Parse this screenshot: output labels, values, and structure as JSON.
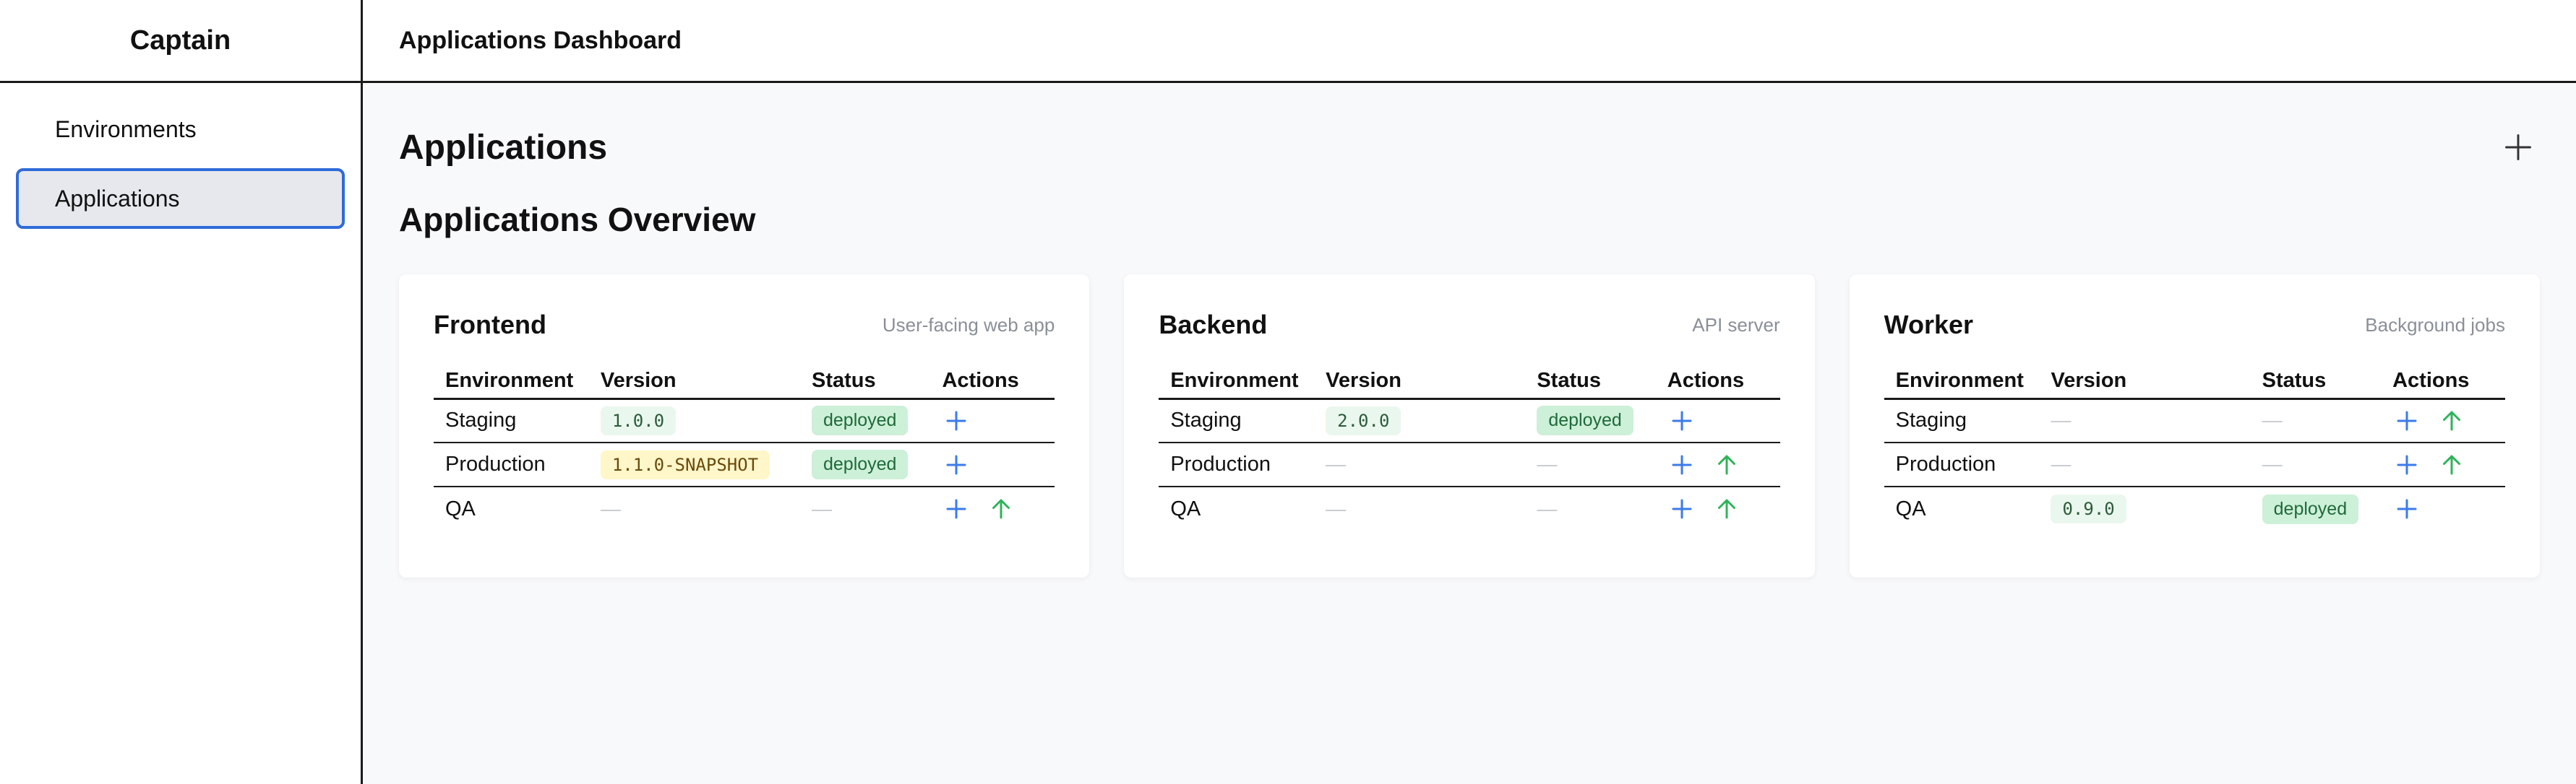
{
  "app": {
    "brand": "Captain",
    "header_title": "Applications Dashboard"
  },
  "sidebar": {
    "items": [
      {
        "label": "Environments",
        "active": false
      },
      {
        "label": "Applications",
        "active": true
      }
    ]
  },
  "main": {
    "title": "Applications",
    "section_title": "Applications Overview",
    "columns": [
      "Environment",
      "Version",
      "Status",
      "Actions"
    ]
  },
  "cards": [
    {
      "name": "Frontend",
      "description": "User-facing web app",
      "rows": [
        {
          "env": "Staging",
          "version": "1.0.0",
          "version_kind": "release",
          "status": "deployed",
          "actions": [
            "plus-icon"
          ]
        },
        {
          "env": "Production",
          "version": "1.1.0-SNAPSHOT",
          "version_kind": "snapshot",
          "status": "deployed",
          "actions": [
            "plus-icon"
          ]
        },
        {
          "env": "QA",
          "version": "—",
          "version_kind": "none",
          "status": "—",
          "actions": [
            "plus-icon",
            "arrow-up-icon"
          ]
        }
      ]
    },
    {
      "name": "Backend",
      "description": "API server",
      "rows": [
        {
          "env": "Staging",
          "version": "2.0.0",
          "version_kind": "release",
          "status": "deployed",
          "actions": [
            "plus-icon"
          ]
        },
        {
          "env": "Production",
          "version": "—",
          "version_kind": "none",
          "status": "—",
          "actions": [
            "plus-icon",
            "arrow-up-icon"
          ]
        },
        {
          "env": "QA",
          "version": "—",
          "version_kind": "none",
          "status": "—",
          "actions": [
            "plus-icon",
            "arrow-up-icon"
          ]
        }
      ]
    },
    {
      "name": "Worker",
      "description": "Background jobs",
      "rows": [
        {
          "env": "Staging",
          "version": "—",
          "version_kind": "none",
          "status": "—",
          "actions": [
            "plus-icon",
            "arrow-up-icon"
          ]
        },
        {
          "env": "Production",
          "version": "—",
          "version_kind": "none",
          "status": "—",
          "actions": [
            "plus-icon",
            "arrow-up-icon"
          ]
        },
        {
          "env": "QA",
          "version": "0.9.0",
          "version_kind": "release",
          "status": "deployed",
          "actions": [
            "plus-icon"
          ]
        }
      ]
    }
  ],
  "colors": {
    "accent_blue": "#3b7bea",
    "accent_green": "#2fb35a",
    "active_border": "#2f6bd8"
  },
  "icons": {
    "add_application": "plus-icon"
  }
}
